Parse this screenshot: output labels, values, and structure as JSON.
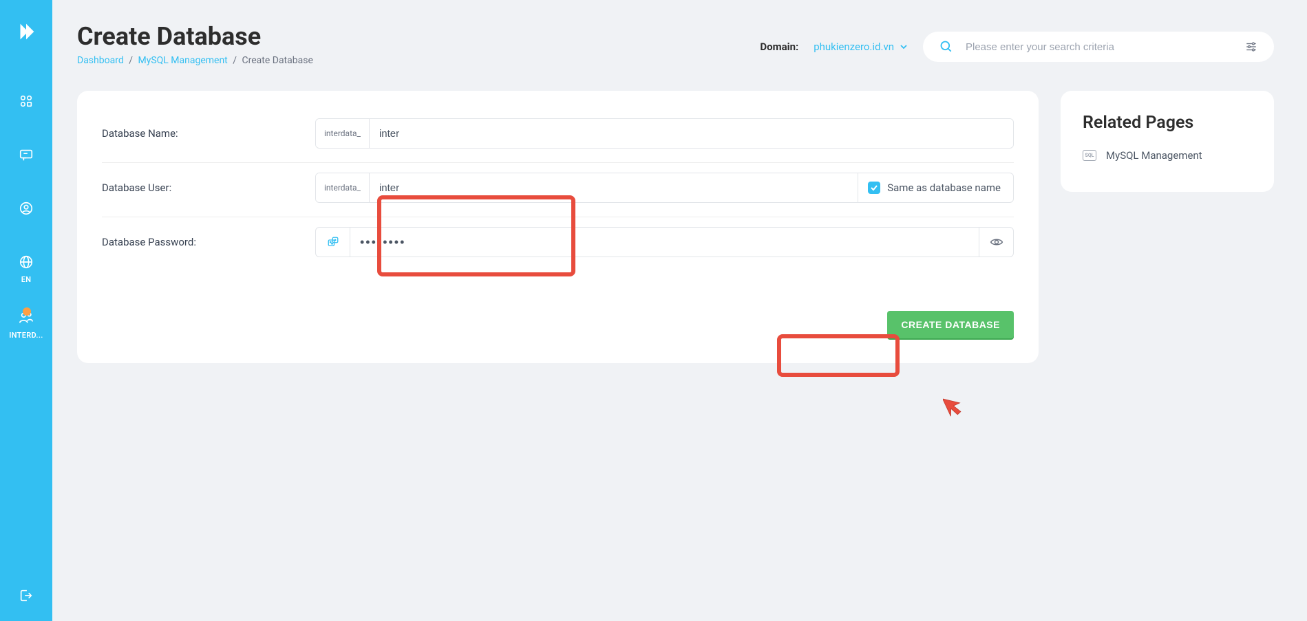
{
  "sidebar": {
    "lang_label": "EN",
    "user_label": "INTERD..."
  },
  "header": {
    "title": "Create Database",
    "breadcrumb": {
      "dashboard": "Dashboard",
      "mysql": "MySQL Management",
      "current": "Create Database"
    },
    "domain_label": "Domain:",
    "domain_value": "phukienzero.id.vn",
    "search_placeholder": "Please enter your search criteria"
  },
  "form": {
    "db_name_label": "Database Name:",
    "db_name_prefix": "interdata_",
    "db_name_value": "inter",
    "db_user_label": "Database User:",
    "db_user_prefix": "interdata_",
    "db_user_value": "inter",
    "same_as_label": "Same as database name",
    "db_pwd_label": "Database Password:",
    "db_pwd_value": "••••••••",
    "create_btn": "CREATE DATABASE"
  },
  "related": {
    "title": "Related Pages",
    "mysql_mgmt": "MySQL Management"
  }
}
